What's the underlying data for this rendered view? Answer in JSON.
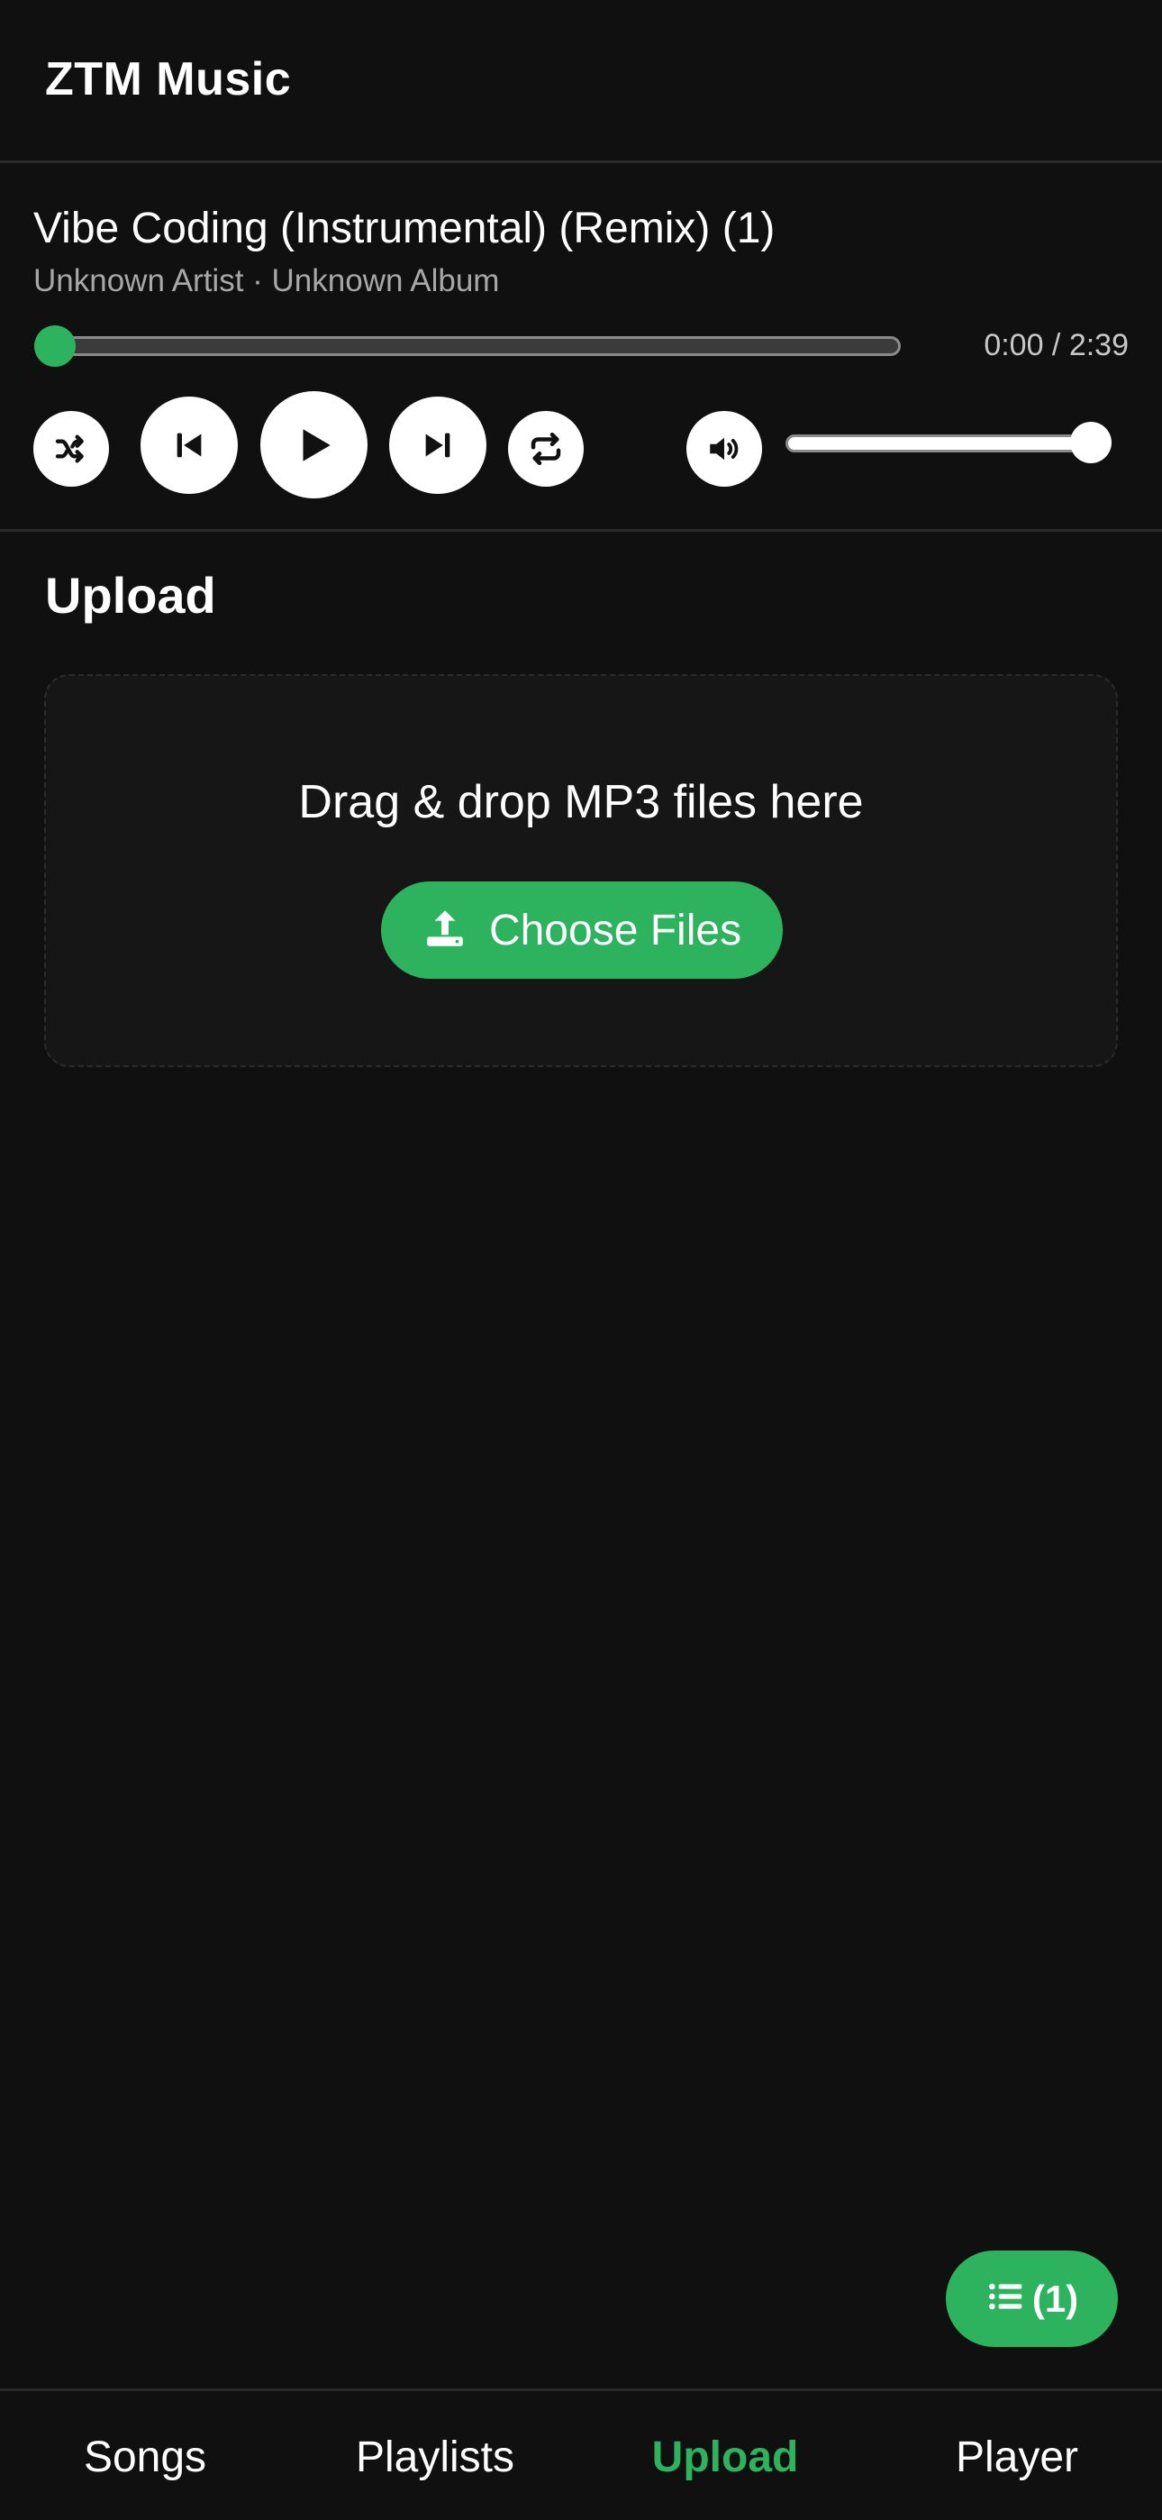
{
  "app": {
    "title": "ZTM Music"
  },
  "now_playing": {
    "title": "Vibe Coding (Instrumental) (Remix) (1)",
    "meta": "Unknown Artist · Unknown Album",
    "time": "0:00 / 2:39",
    "progress_fraction": 0.0,
    "volume_fraction": 1.0
  },
  "controls": {
    "shuffle_icon": "shuffle-icon",
    "previous_icon": "skip-previous-icon",
    "play_icon": "play-icon",
    "next_icon": "skip-next-icon",
    "repeat_icon": "repeat-icon",
    "volume_icon": "volume-icon"
  },
  "upload": {
    "section_title": "Upload",
    "drop_text": "Drag & drop MP3 files here",
    "button_label": "Choose Files",
    "button_icon": "upload-icon"
  },
  "queue": {
    "icon": "list-icon",
    "count_label": "(1)"
  },
  "nav": {
    "items": [
      {
        "label": "Songs",
        "active": false
      },
      {
        "label": "Playlists",
        "active": false
      },
      {
        "label": "Upload",
        "active": true
      },
      {
        "label": "Player",
        "active": false
      }
    ]
  },
  "colors": {
    "accent": "#2db35d",
    "background": "#101010",
    "text": "#ffffff",
    "muted_text": "#a8a8a8"
  }
}
